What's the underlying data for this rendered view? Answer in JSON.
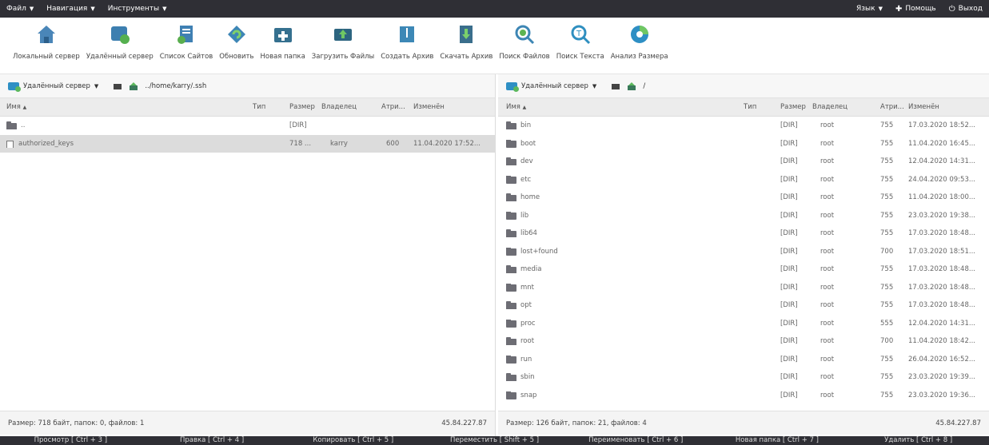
{
  "menubar": {
    "file": "Файл",
    "navigation": "Навигация",
    "tools": "Инструменты",
    "language": "Язык",
    "help": "Помощь",
    "logout": "Выход"
  },
  "toolbar": [
    {
      "label": "Локальный сервер",
      "icon": "local-server-icon"
    },
    {
      "label": "Удалённый сервер",
      "icon": "remote-server-icon"
    },
    {
      "label": "Список Сайтов",
      "icon": "site-list-icon"
    },
    {
      "label": "Обновить",
      "icon": "refresh-icon"
    },
    {
      "label": "Новая папка",
      "icon": "new-folder-icon"
    },
    {
      "label": "Загрузить Файлы",
      "icon": "upload-icon"
    },
    {
      "label": "Создать Архив",
      "icon": "archive-icon"
    },
    {
      "label": "Скачать Архив",
      "icon": "download-archive-icon"
    },
    {
      "label": "Поиск Файлов",
      "icon": "search-files-icon"
    },
    {
      "label": "Поиск Текста",
      "icon": "search-text-icon"
    },
    {
      "label": "Анализ Размера",
      "icon": "size-analysis-icon"
    }
  ],
  "left": {
    "server": "Удалённый сервер",
    "path": "../home/karry/.ssh",
    "columns": {
      "name": "Имя",
      "type": "Тип",
      "size": "Размер",
      "owner": "Владелец",
      "attr": "Атри...",
      "modified": "Изменён"
    },
    "rows": [
      {
        "name": "..",
        "kind": "folder",
        "type": "",
        "size": "[DIR]",
        "owner": "",
        "attr": "",
        "modified": ""
      },
      {
        "name": "authorized_keys",
        "kind": "file",
        "type": "",
        "size": "718 ...",
        "owner": "karry",
        "attr": "600",
        "modified": "11.04.2020 17:52..."
      }
    ],
    "status": "Размер: 718 байт, папок: 0, файлов: 1",
    "ip": "45.84.227.87"
  },
  "right": {
    "server": "Удалённый сервер",
    "path": "/",
    "columns": {
      "name": "Имя",
      "type": "Тип",
      "size": "Размер",
      "owner": "Владелец",
      "attr": "Атри...",
      "modified": "Изменён"
    },
    "rows": [
      {
        "name": "bin",
        "size": "[DIR]",
        "owner": "root",
        "attr": "755",
        "modified": "17.03.2020 18:52..."
      },
      {
        "name": "boot",
        "size": "[DIR]",
        "owner": "root",
        "attr": "755",
        "modified": "11.04.2020 16:45..."
      },
      {
        "name": "dev",
        "size": "[DIR]",
        "owner": "root",
        "attr": "755",
        "modified": "12.04.2020 14:31..."
      },
      {
        "name": "etc",
        "size": "[DIR]",
        "owner": "root",
        "attr": "755",
        "modified": "24.04.2020 09:53..."
      },
      {
        "name": "home",
        "size": "[DIR]",
        "owner": "root",
        "attr": "755",
        "modified": "11.04.2020 18:00..."
      },
      {
        "name": "lib",
        "size": "[DIR]",
        "owner": "root",
        "attr": "755",
        "modified": "23.03.2020 19:38..."
      },
      {
        "name": "lib64",
        "size": "[DIR]",
        "owner": "root",
        "attr": "755",
        "modified": "17.03.2020 18:48..."
      },
      {
        "name": "lost+found",
        "size": "[DIR]",
        "owner": "root",
        "attr": "700",
        "modified": "17.03.2020 18:51..."
      },
      {
        "name": "media",
        "size": "[DIR]",
        "owner": "root",
        "attr": "755",
        "modified": "17.03.2020 18:48..."
      },
      {
        "name": "mnt",
        "size": "[DIR]",
        "owner": "root",
        "attr": "755",
        "modified": "17.03.2020 18:48..."
      },
      {
        "name": "opt",
        "size": "[DIR]",
        "owner": "root",
        "attr": "755",
        "modified": "17.03.2020 18:48..."
      },
      {
        "name": "proc",
        "size": "[DIR]",
        "owner": "root",
        "attr": "555",
        "modified": "12.04.2020 14:31..."
      },
      {
        "name": "root",
        "size": "[DIR]",
        "owner": "root",
        "attr": "700",
        "modified": "11.04.2020 18:42..."
      },
      {
        "name": "run",
        "size": "[DIR]",
        "owner": "root",
        "attr": "755",
        "modified": "26.04.2020 16:52..."
      },
      {
        "name": "sbin",
        "size": "[DIR]",
        "owner": "root",
        "attr": "755",
        "modified": "23.03.2020 19:39..."
      },
      {
        "name": "snap",
        "size": "[DIR]",
        "owner": "root",
        "attr": "755",
        "modified": "23.03.2020 19:36..."
      }
    ],
    "status": "Размер: 126 байт, папок: 21, файлов: 4",
    "ip": "45.84.227.87"
  },
  "fkeys": [
    "Просмотр [ Ctrl + 3 ]",
    "Правка [ Ctrl + 4 ]",
    "Копировать [ Ctrl + 5 ]",
    "Переместить [ Shift + 5 ]",
    "Переименовать [ Ctrl + 6 ]",
    "Новая папка [ Ctrl + 7 ]",
    "Удалить [ Ctrl + 8 ]"
  ],
  "colors": {
    "menubar": "#2f2f35",
    "accent": "#2e8fc4",
    "selected_row": "#dcdcdc"
  }
}
